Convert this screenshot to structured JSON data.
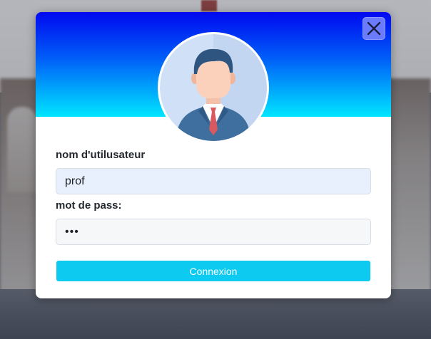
{
  "login": {
    "username_label": "nom d'utilusateur",
    "username_value": "prof",
    "password_label": "mot de pass:",
    "password_value": "abc",
    "submit_label": "Connexion"
  },
  "icons": {
    "close": "close-icon",
    "avatar": "user-avatar-icon"
  },
  "colors": {
    "header_gradient_top": "#0008f0",
    "header_gradient_bottom": "#00e6ff",
    "submit_button": "#0dcaf0",
    "close_button": "#6b7bff",
    "username_field_bg": "#e8effd"
  }
}
